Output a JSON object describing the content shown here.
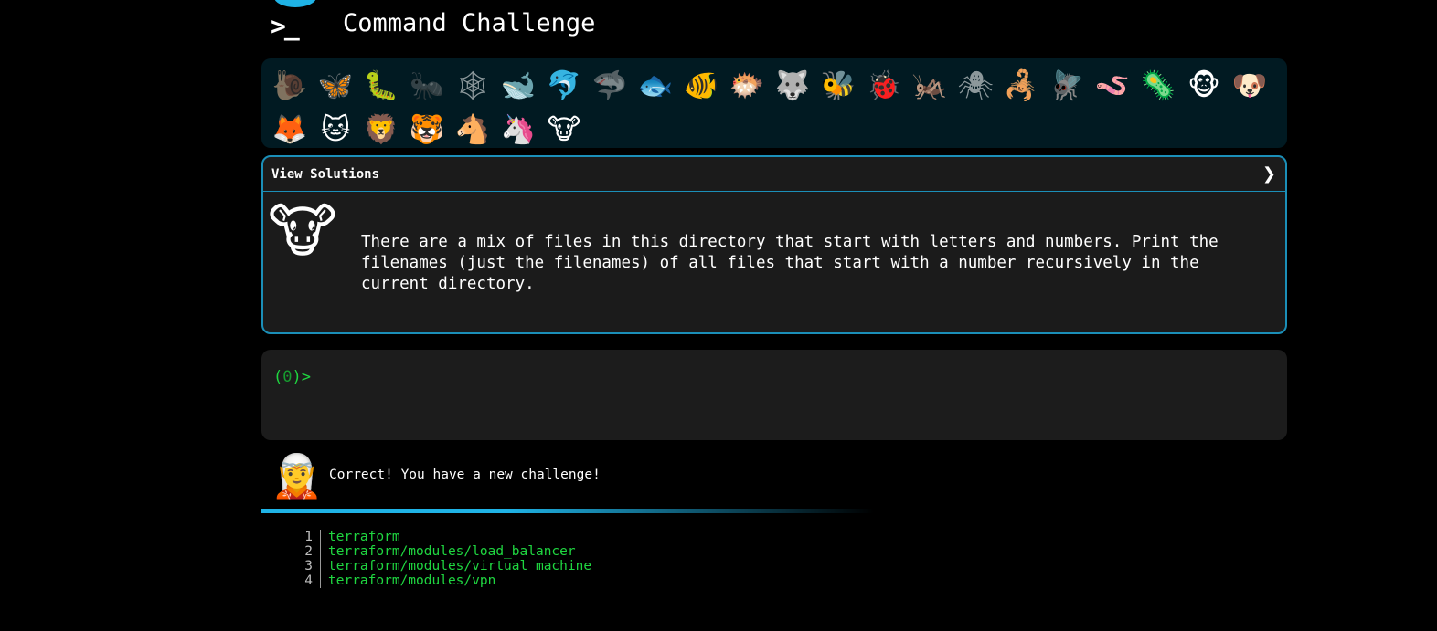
{
  "app": {
    "logo_text": ">_",
    "title": "Command Challenge"
  },
  "animals": [
    {
      "name": "snail",
      "glyph": "🐌",
      "active": false
    },
    {
      "name": "butterfly",
      "glyph": "🦋",
      "active": true
    },
    {
      "name": "caterpillar",
      "glyph": "🐛",
      "active": true
    },
    {
      "name": "ant",
      "glyph": "🐜",
      "active": false
    },
    {
      "name": "spider-web",
      "glyph": "🕸",
      "active": false
    },
    {
      "name": "whale",
      "glyph": "🐋",
      "active": true
    },
    {
      "name": "dolphin",
      "glyph": "🐬",
      "active": true
    },
    {
      "name": "shark",
      "glyph": "🦈",
      "active": false
    },
    {
      "name": "fish",
      "glyph": "🐟",
      "active": true
    },
    {
      "name": "tropical-fish",
      "glyph": "🐠",
      "active": true
    },
    {
      "name": "pufferfish",
      "glyph": "🐡",
      "active": true
    },
    {
      "name": "wolf",
      "glyph": "🐺",
      "active": true
    },
    {
      "name": "bee",
      "glyph": "🐝",
      "active": true
    },
    {
      "name": "ladybug",
      "glyph": "🐞",
      "active": true
    },
    {
      "name": "cricket",
      "glyph": "🦗",
      "active": true
    },
    {
      "name": "spider",
      "glyph": "🕷",
      "active": false
    },
    {
      "name": "scorpion",
      "glyph": "🦂",
      "active": true
    },
    {
      "name": "fly",
      "glyph": "🪰",
      "active": true
    },
    {
      "name": "worm",
      "glyph": "🪱",
      "active": true
    },
    {
      "name": "microbe",
      "glyph": "🦠",
      "active": true
    },
    {
      "name": "monkey",
      "glyph": "🐵",
      "active": true
    },
    {
      "name": "dog",
      "glyph": "🐶",
      "active": true
    },
    {
      "name": "fox",
      "glyph": "🦊",
      "active": true
    },
    {
      "name": "cat",
      "glyph": "🐱",
      "active": true
    },
    {
      "name": "lion",
      "glyph": "🦁",
      "active": true
    },
    {
      "name": "tiger",
      "glyph": "🐯",
      "active": true
    },
    {
      "name": "horse",
      "glyph": "🐴",
      "active": true
    },
    {
      "name": "unicorn",
      "glyph": "🦄",
      "active": true
    },
    {
      "name": "cow",
      "glyph": "🐮",
      "active": true
    }
  ],
  "challenge": {
    "header_label": "View Solutions",
    "toggle_glyph": "❯",
    "icon_glyph": "🐮",
    "text": "There are a mix of files in this directory that start with letters and numbers. Print the filenames (just the filenames) of all files that start with a number recursively in the current directory."
  },
  "terminal": {
    "prompt_open": "(",
    "prompt_num": "0",
    "prompt_close": ")>"
  },
  "feedback": {
    "icon_glyph": "🧝",
    "text": "Correct! You have a new challenge!"
  },
  "progress": {
    "fraction": 0.4
  },
  "output": [
    {
      "line": "1",
      "text": "terraform"
    },
    {
      "line": "2",
      "text": "terraform/modules/load_balancer"
    },
    {
      "line": "3",
      "text": "terraform/modules/virtual_machine"
    },
    {
      "line": "4",
      "text": "terraform/modules/vpn"
    }
  ],
  "colors": {
    "accent": "#1fb3e6",
    "border": "#1b8fb8",
    "terminal_green": "#1fd640",
    "panel_bg": "#011a22"
  }
}
